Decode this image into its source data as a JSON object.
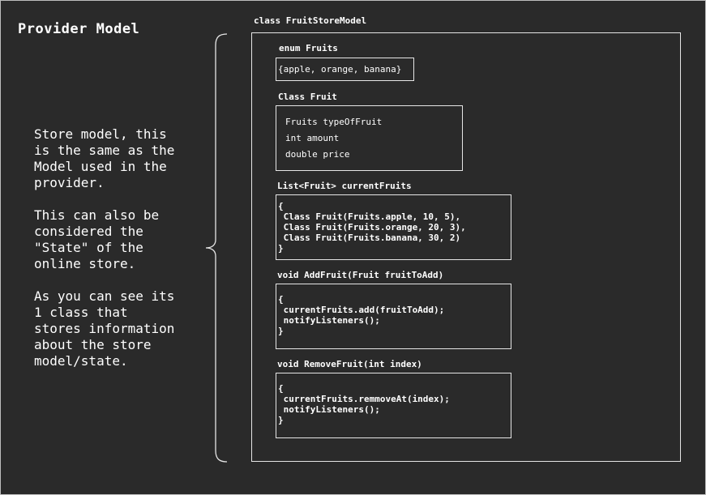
{
  "page_title": "Provider Model",
  "description": "Store model, this\nis the same as the\nModel used in the\nprovider.\n\nThis can also be\nconsidered the\n\"State\" of the\nonline store.\n\nAs you can see its\n1 class that\nstores information\nabout the store\nmodel/state.",
  "class_title": "class FruitStoreModel",
  "enum_fruits": {
    "label": "enum Fruits",
    "values": "{apple, orange, banana}"
  },
  "class_fruit": {
    "label": "Class Fruit",
    "fields": [
      "Fruits typeOfFruit",
      "int amount",
      "double price"
    ]
  },
  "current_fruits": {
    "label": "List<Fruit> currentFruits",
    "code": "{\n Class Fruit(Fruits.apple, 10, 5),\n Class Fruit(Fruits.orange, 20, 3),\n Class Fruit(Fruits.banana, 30, 2)\n}"
  },
  "add_fruit": {
    "label": "void AddFruit(Fruit fruitToAdd)",
    "code": "{\n currentFruits.add(fruitToAdd);\n notifyListeners();\n}"
  },
  "remove_fruit": {
    "label": "void RemoveFruit(int index)",
    "code": "{\n currentFruits.remmoveAt(index);\n notifyListeners();\n}"
  },
  "colors": {
    "background": "#2a2a2a",
    "foreground": "#ffffff",
    "border": "#e6e6e6"
  }
}
